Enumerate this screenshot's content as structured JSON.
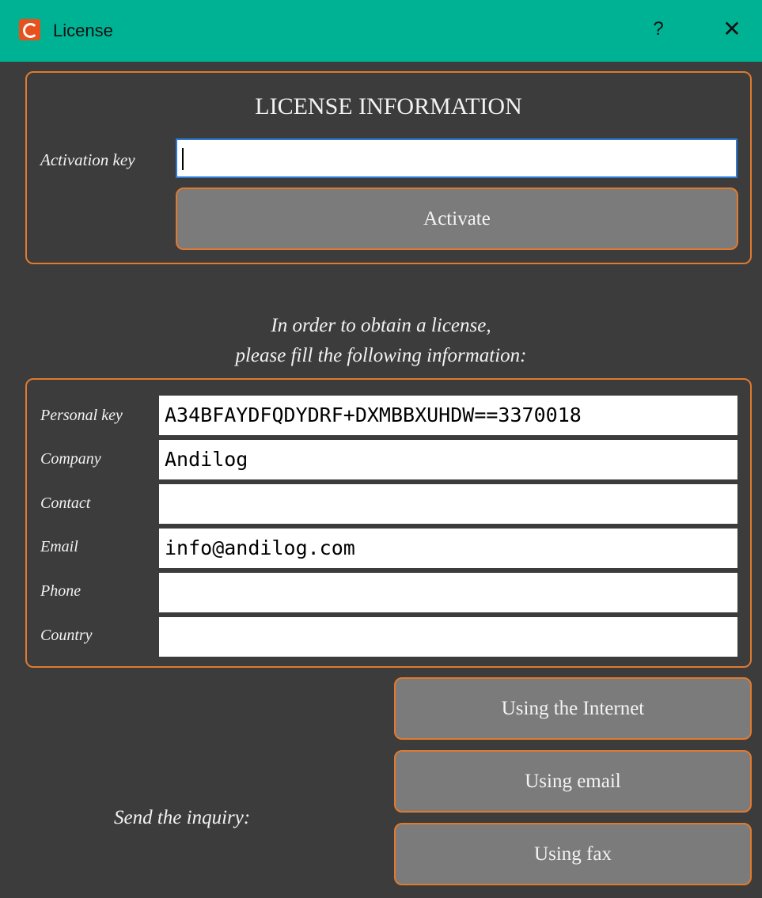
{
  "window": {
    "title": "License",
    "help_label": "?",
    "close_label": "✕",
    "accent_color": "#00b294",
    "border_color": "#e07a2e"
  },
  "license": {
    "heading": "LICENSE INFORMATION",
    "activation_label": "Activation key",
    "activation_value": "",
    "activate_label": "Activate"
  },
  "instructions": {
    "line1": "In order to obtain a license,",
    "line2": "please fill the following information:"
  },
  "fields": {
    "personal_key": {
      "label": "Personal key",
      "value": "A34BFAYDFQDYDRF+DXMBBXUHDW==3370018"
    },
    "company": {
      "label": "Company",
      "value": "Andilog"
    },
    "contact": {
      "label": "Contact",
      "value": ""
    },
    "email": {
      "label": "Email",
      "value": "info@andilog.com"
    },
    "phone": {
      "label": "Phone",
      "value": ""
    },
    "country": {
      "label": "Country",
      "value": ""
    }
  },
  "send": {
    "label": "Send the inquiry:",
    "internet_label": "Using the Internet",
    "email_label": "Using email",
    "fax_label": "Using fax"
  }
}
